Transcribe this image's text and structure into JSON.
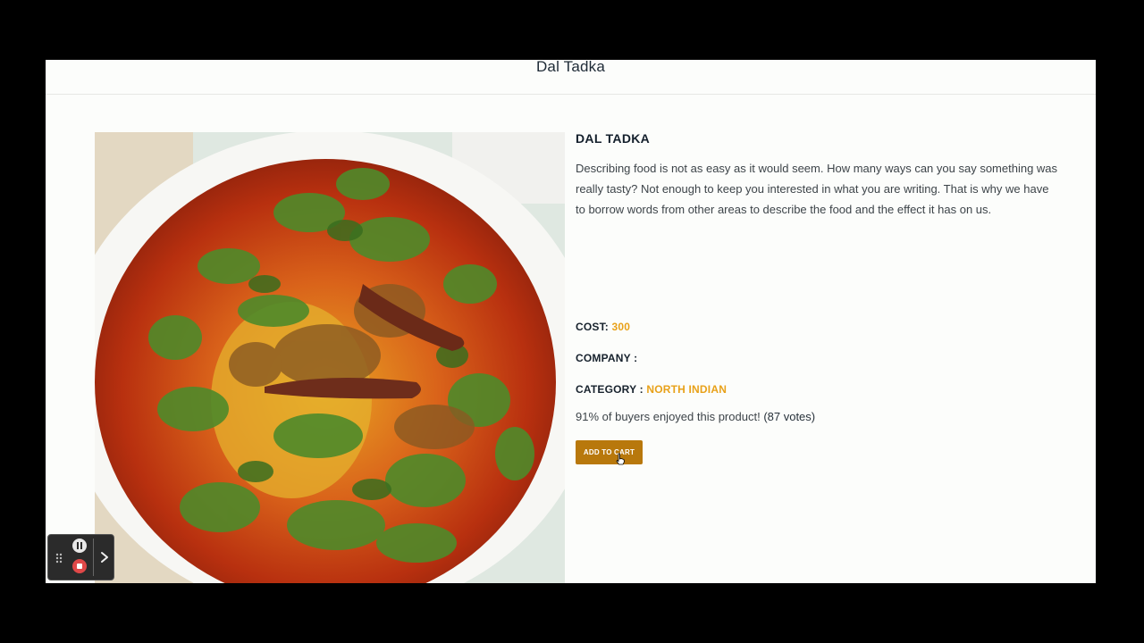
{
  "page": {
    "title": "Dal Tadka"
  },
  "product": {
    "name": "DAL TADKA",
    "description": "Describing food is not as easy as it would seem. How many ways can you say something was really tasty? Not enough to keep you interested in what you are writing. That is why we have to borrow words from other areas to describe the food and the effect it has on us.",
    "cost_label": "COST:",
    "cost_value": "300",
    "company_label": "COMPANY :",
    "company_value": "",
    "category_label": "CATEGORY :",
    "category_value": "NORTH INDIAN",
    "rating_text": "91% of buyers enjoyed this product!",
    "votes_text": "(87 votes)",
    "add_to_cart_label": "ADD TO CART"
  },
  "colors": {
    "accent": "#e8a119",
    "button": "#b8780c",
    "heading": "#14202c"
  },
  "recorder_controls": {
    "icons": [
      "drag-handle-icon",
      "pause-icon",
      "stop-icon",
      "chevron-right-icon"
    ]
  }
}
